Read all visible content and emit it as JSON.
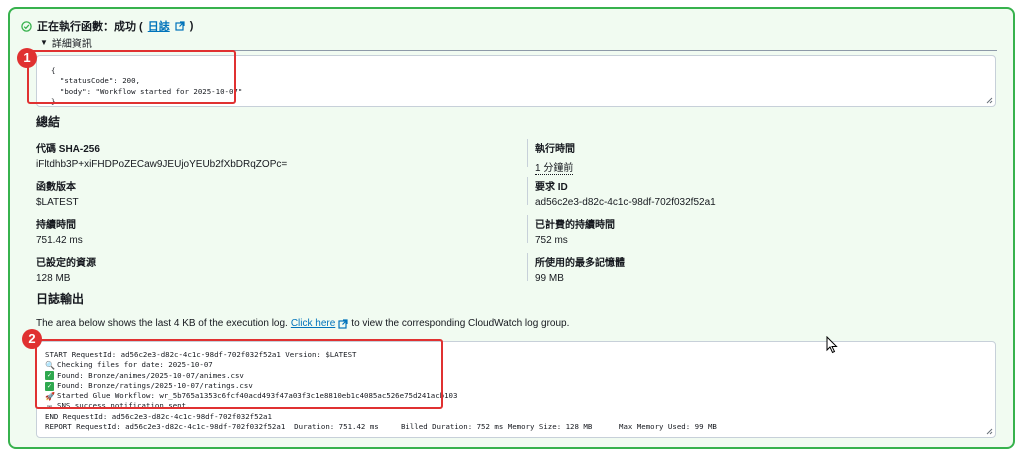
{
  "status": {
    "text": "正在執行函數：成功 (",
    "log_link": "日誌",
    "close": ")"
  },
  "details": {
    "toggle_label": "詳細資訊",
    "response_lines": [
      "{",
      "  \"statusCode\": 200,",
      "  \"body\": \"Workflow started for 2025-10-07\"",
      "}"
    ]
  },
  "summary": {
    "heading": "總結",
    "fields": [
      {
        "label": "代碼 SHA-256",
        "value": "iFltdhb3P+xiFHDPoZECaw9JEUjoYEUb2fXbDRqZOPc="
      },
      {
        "label": "執行時間",
        "value": "1 分鐘前"
      },
      {
        "label": "函數版本",
        "value": "$LATEST"
      },
      {
        "label": "要求 ID",
        "value": "ad56c2e3-d82c-4c1c-98df-702f032f52a1"
      },
      {
        "label": "持續時間",
        "value": "751.42 ms"
      },
      {
        "label": "已計費的持續時間",
        "value": "752 ms"
      },
      {
        "label": "已設定的資源",
        "value": "128 MB"
      },
      {
        "label": "所使用的最多記憶體",
        "value": "99 MB"
      }
    ]
  },
  "log_output": {
    "heading": "日誌輸出",
    "description_before": "The area below shows the last 4 KB of the execution log.",
    "click_here": "Click here",
    "description_after": "to view the corresponding CloudWatch log group.",
    "lines": [
      {
        "icon": "",
        "text": "START RequestId: ad56c2e3-d82c-4c1c-98df-702f032f52a1 Version: $LATEST"
      },
      {
        "icon": "magnifier",
        "text": "Checking files for date: 2025-10-07"
      },
      {
        "icon": "check",
        "text": "Found: Bronze/animes/2025-10-07/animes.csv"
      },
      {
        "icon": "check",
        "text": "Found: Bronze/ratings/2025-10-07/ratings.csv"
      },
      {
        "icon": "rocket",
        "text": "Started Glue Workflow: wr_5b765a1353c6fcf40acd493f47a03f3c1e8810eb1c4085ac526e75d241acb103"
      },
      {
        "icon": "envelope",
        "text": "SNS success notification sent."
      },
      {
        "icon": "",
        "text": "END RequestId: ad56c2e3-d82c-4c1c-98df-702f032f52a1"
      },
      {
        "icon": "",
        "text": "REPORT RequestId: ad56c2e3-d82c-4c1c-98df-702f032f52a1  Duration: 751.42 ms     Billed Duration: 752 ms Memory Size: 128 MB      Max Memory Used: 99 MB"
      }
    ]
  },
  "annotations": [
    "1",
    "2"
  ],
  "colors": {
    "success": "#37b24d",
    "link": "#0073bb",
    "callout": "#e03131",
    "panel_bg": "#f1fbf1"
  }
}
